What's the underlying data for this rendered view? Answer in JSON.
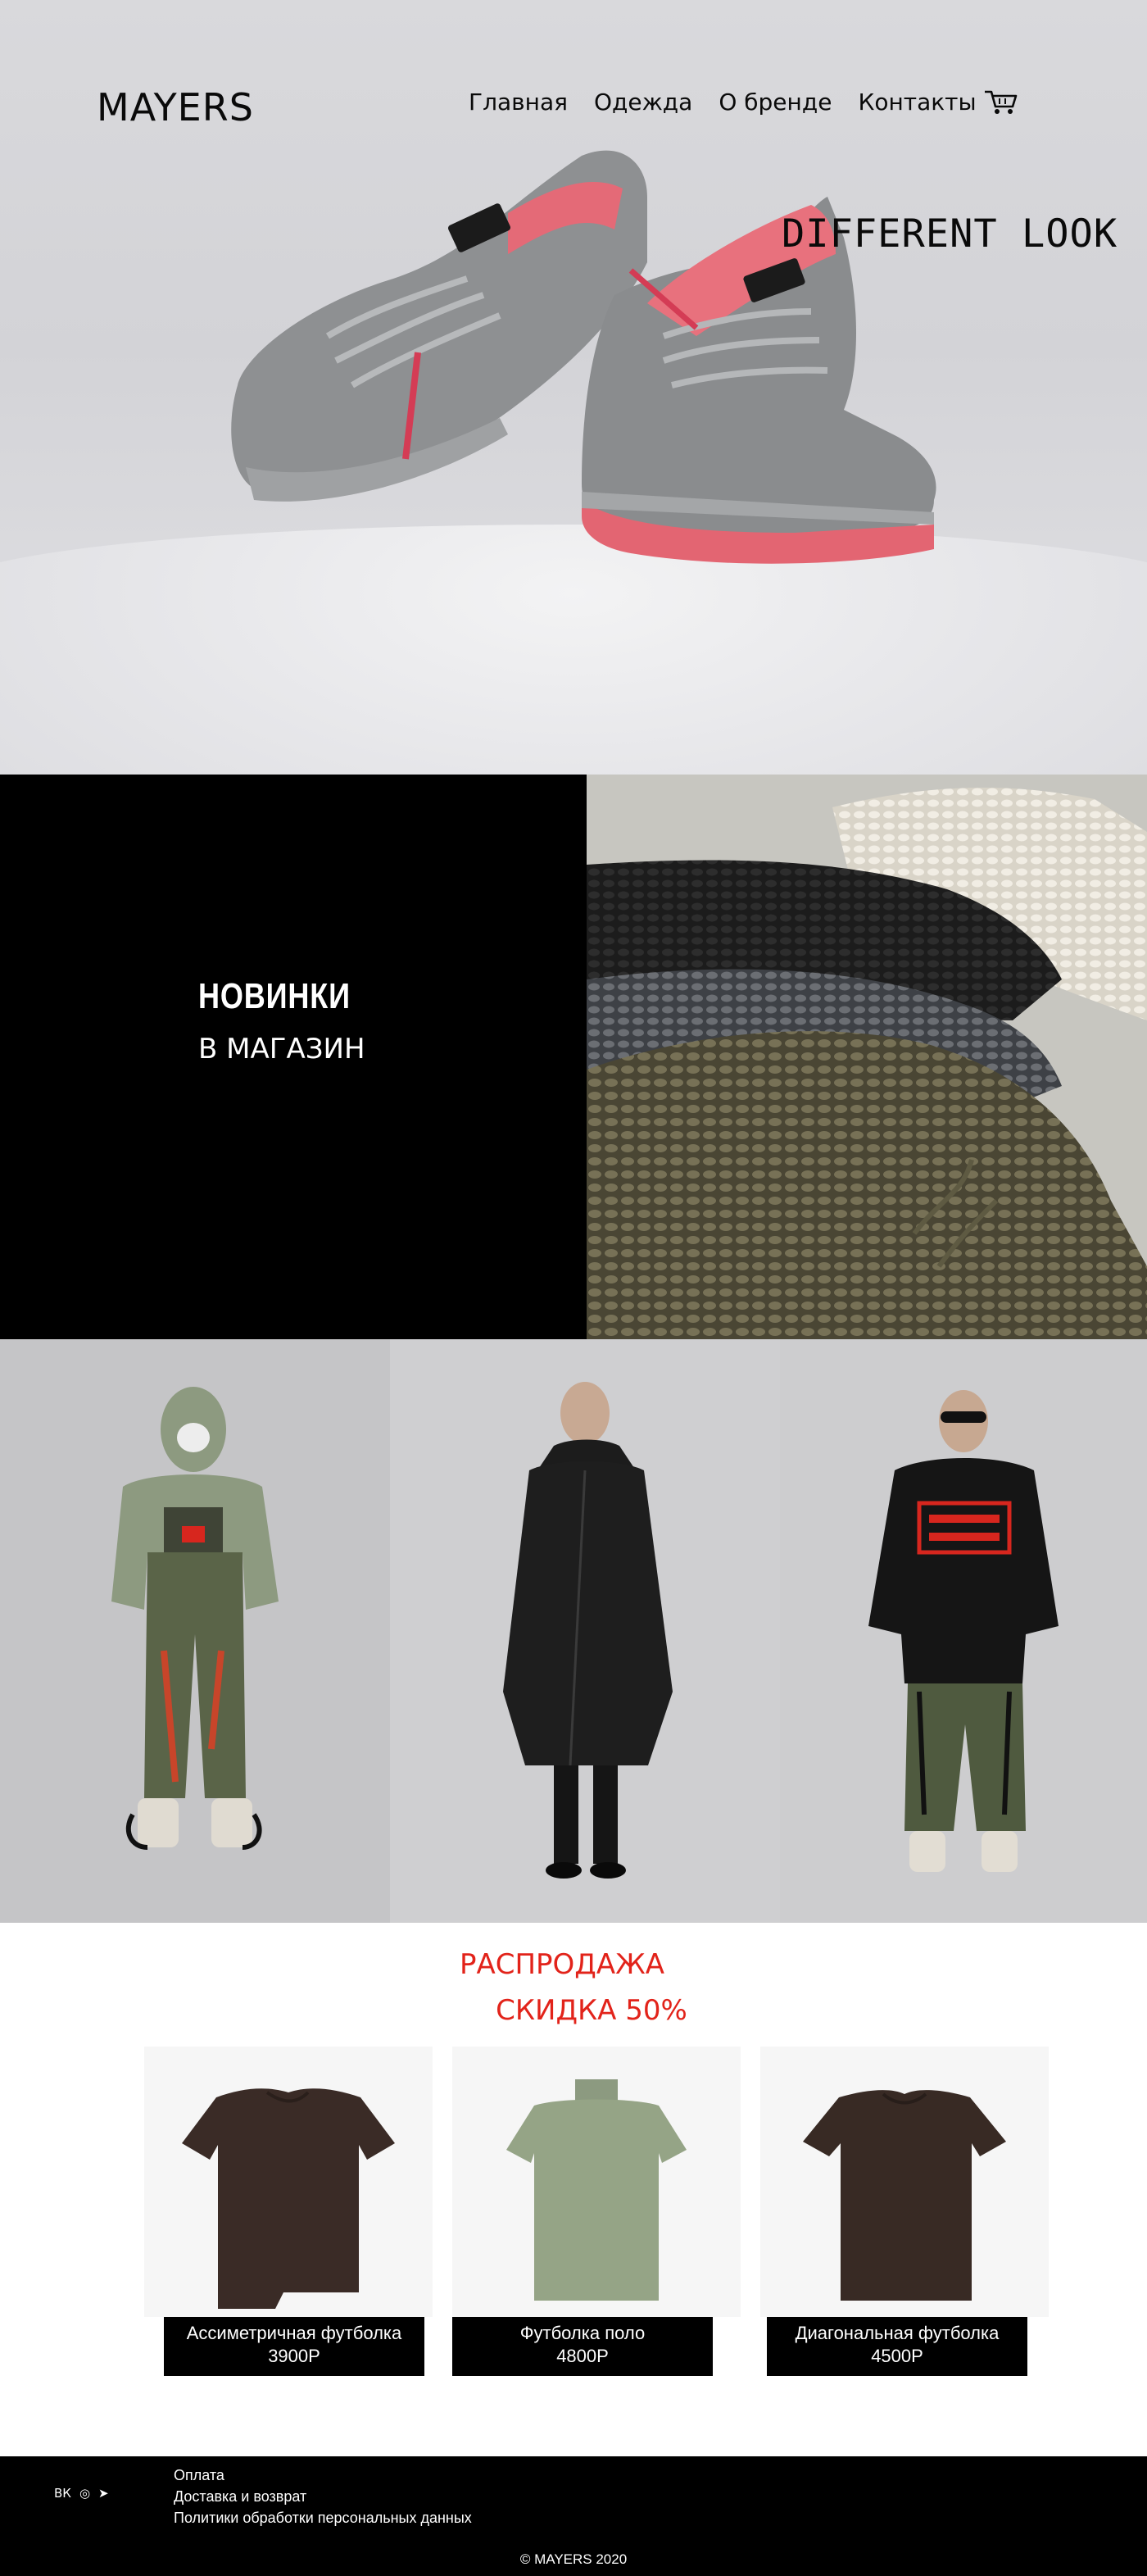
{
  "brand": {
    "logo": "MAYERS"
  },
  "nav": {
    "items": [
      {
        "label": "Главная"
      },
      {
        "label": "Одежда"
      },
      {
        "label": "О бренде"
      },
      {
        "label": "Контакты"
      }
    ],
    "cart_icon": "cart-icon"
  },
  "hero": {
    "tagline": "DIFFERENT LOOK",
    "image": "grey-suede-sneakers-photo"
  },
  "promo": {
    "title": "НОВИНКИ",
    "subtitle": "В МАГАЗИН",
    "image": "knitted-scarves-photo"
  },
  "lookbook": [
    {
      "image": "look-green-jumpsuit-mask"
    },
    {
      "image": "look-black-coat"
    },
    {
      "image": "look-black-sweater-print"
    }
  ],
  "sale": {
    "title_line1": "РАСПРОДАЖА",
    "title_line2": "СКИДКА 50%",
    "accent_color": "#e2231a",
    "products": [
      {
        "name": "Ассиметричная футболка",
        "price": "3900Р",
        "image": "brown-asymmetric-tshirt"
      },
      {
        "name": "Футболка поло",
        "price": "4800Р",
        "image": "green-polo-shirt"
      },
      {
        "name": "Диагональная футболка",
        "price": "4500Р",
        "image": "brown-diagonal-tshirt"
      }
    ]
  },
  "footer": {
    "social": [
      {
        "icon": "vk-icon",
        "glyph": "ВК"
      },
      {
        "icon": "instagram-icon",
        "glyph": "◎"
      },
      {
        "icon": "telegram-icon",
        "glyph": "➤"
      }
    ],
    "links": [
      {
        "label": "Оплата"
      },
      {
        "label": "Доставка и возврат"
      },
      {
        "label": "Политики обработки персональных данных"
      }
    ],
    "copyright": "© MAYERS 2020"
  }
}
